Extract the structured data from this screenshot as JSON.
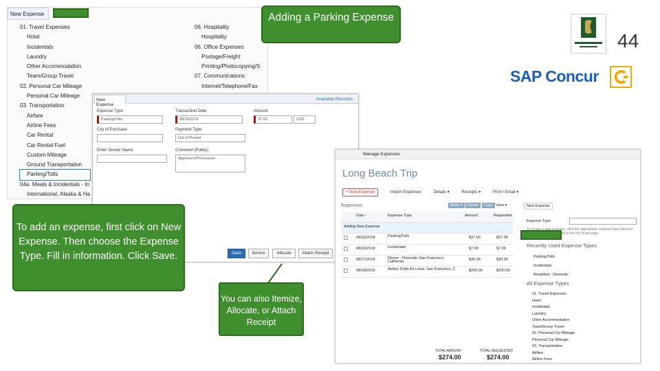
{
  "title_callout": "Adding a Parking Expense",
  "slide_number": "44",
  "brand": {
    "concur": "SAP Concur"
  },
  "type_list": {
    "tab_label": "New Expense",
    "left_col": [
      {
        "t": "01. Travel Expenses",
        "s": true
      },
      {
        "t": "Hotel"
      },
      {
        "t": "Incidentals"
      },
      {
        "t": "Laundry"
      },
      {
        "t": "Other Accommodation"
      },
      {
        "t": "Team/Group Travel"
      },
      {
        "t": "02. Personal Car Mileage",
        "s": true
      },
      {
        "t": "Personal Car Mileage"
      },
      {
        "t": "03. Transportation",
        "s": true
      },
      {
        "t": "Airfare"
      },
      {
        "t": "Airline Fees"
      },
      {
        "t": "Car Rental"
      },
      {
        "t": "Car Rental Fuel"
      },
      {
        "t": "Custom Mileage"
      },
      {
        "t": "Ground Transportation"
      },
      {
        "t": "Parking/Tolls",
        "h": true
      },
      {
        "t": "04a. Meals & Incidentals - In",
        "s": true
      },
      {
        "t": "International, Alaska & Ha"
      }
    ],
    "right_col": [
      {
        "t": "06. Hospitality",
        "s": true
      },
      {
        "t": "Hospitality"
      },
      {
        "t": "06. Office Expenses",
        "s": true
      },
      {
        "t": "Postage/Freight"
      },
      {
        "t": "Printing/Photocopying/S"
      },
      {
        "t": "07. Communications",
        "s": true
      },
      {
        "t": "Internet/Telephone/Fax"
      }
    ]
  },
  "form": {
    "tab": "New Expense",
    "available_receipts": "Available Receipts",
    "expense_type_lbl": "Expense Type",
    "expense_type_val": "Parking/Tolls",
    "date_lbl": "Transaction Date",
    "date_val": "08/16/2018",
    "amount_lbl": "Amount",
    "amount_val": "37.00",
    "currency_val": "USD",
    "city_lbl": "City of Purchase",
    "payment_lbl": "Payment Type",
    "payment_val": "Out of Pocket",
    "vendor_lbl": "Enter Vendor Name",
    "comment_lbl": "Comment (Public)",
    "comment_hint": "Approvers/Processors",
    "save": "Save",
    "itemize": "Itemize",
    "allocate": "Allocate",
    "attach": "Attach Receipt"
  },
  "manager": {
    "header": "Manage Expenses",
    "trip": "Long Beach Trip",
    "new_expense": "+ New Expense",
    "import": "Import Expenses",
    "details": "Details ▾",
    "receipts": "Receipts ▾",
    "print": "Print / Email ▾",
    "expenses_lbl": "Expenses",
    "move": "Move ▾",
    "delete": "Delete",
    "copy": "Copy",
    "view": "View ▾",
    "cols": [
      "Date ↑",
      "Expense Type",
      "Amount",
      "Requested"
    ],
    "adding": "Adding New Expense",
    "rows": [
      {
        "date": "08/16/2018",
        "type": "Parking/Tolls",
        "amt": "$37.00",
        "req": "$37.00"
      },
      {
        "date": "08/16/2018",
        "type": "Incidentals",
        "amt": "$7.00",
        "req": "$7.00"
      },
      {
        "date": "08/17/2018",
        "type": "Dinner - Domestic San Francisco, California",
        "amt": "$30.00",
        "req": "$30.00"
      },
      {
        "date": "08/18/2018",
        "type": "Airfare Delta Air Lines, San Francisco, C",
        "amt": "$200.00",
        "req": "$200.00"
      }
    ],
    "total_amount_lbl": "TOTAL AMOUNT",
    "total_amount": "$274.00",
    "total_req_lbl": "TOTAL REQUESTED",
    "total_req": "$274.00",
    "side_tab": "New Expense",
    "side_type_lbl": "Expense Type",
    "side_hint": "To create a new expense, click the appropriate expense type below or type the name in the field to the left of the page",
    "recent_hdr": "Recently Used Expense Types",
    "recent": [
      "Parking/Tolls",
      "Incidentals",
      "Breakfast - Domestic"
    ],
    "all_hdr": "All Expense Types",
    "all": [
      {
        "t": "01. Travel Expenses",
        "s": true
      },
      {
        "t": "Hotel"
      },
      {
        "t": "Incidentals"
      },
      {
        "t": "Laundry"
      },
      {
        "t": "Other Accommodation"
      },
      {
        "t": "Team/Group Travel"
      },
      {
        "t": "02. Personal Car Mileage",
        "s": true
      },
      {
        "t": "Personal Car Mileage"
      },
      {
        "t": "03. Transportation",
        "s": true
      },
      {
        "t": "Airfare"
      },
      {
        "t": "Airline Fees"
      }
    ]
  },
  "instruction": "To add an expense, first click on New Expense. Then choose the Expense Type. Fill in information. Click Save.",
  "also_note": "You can also Itemize, Allocate, or Attach Receipt"
}
